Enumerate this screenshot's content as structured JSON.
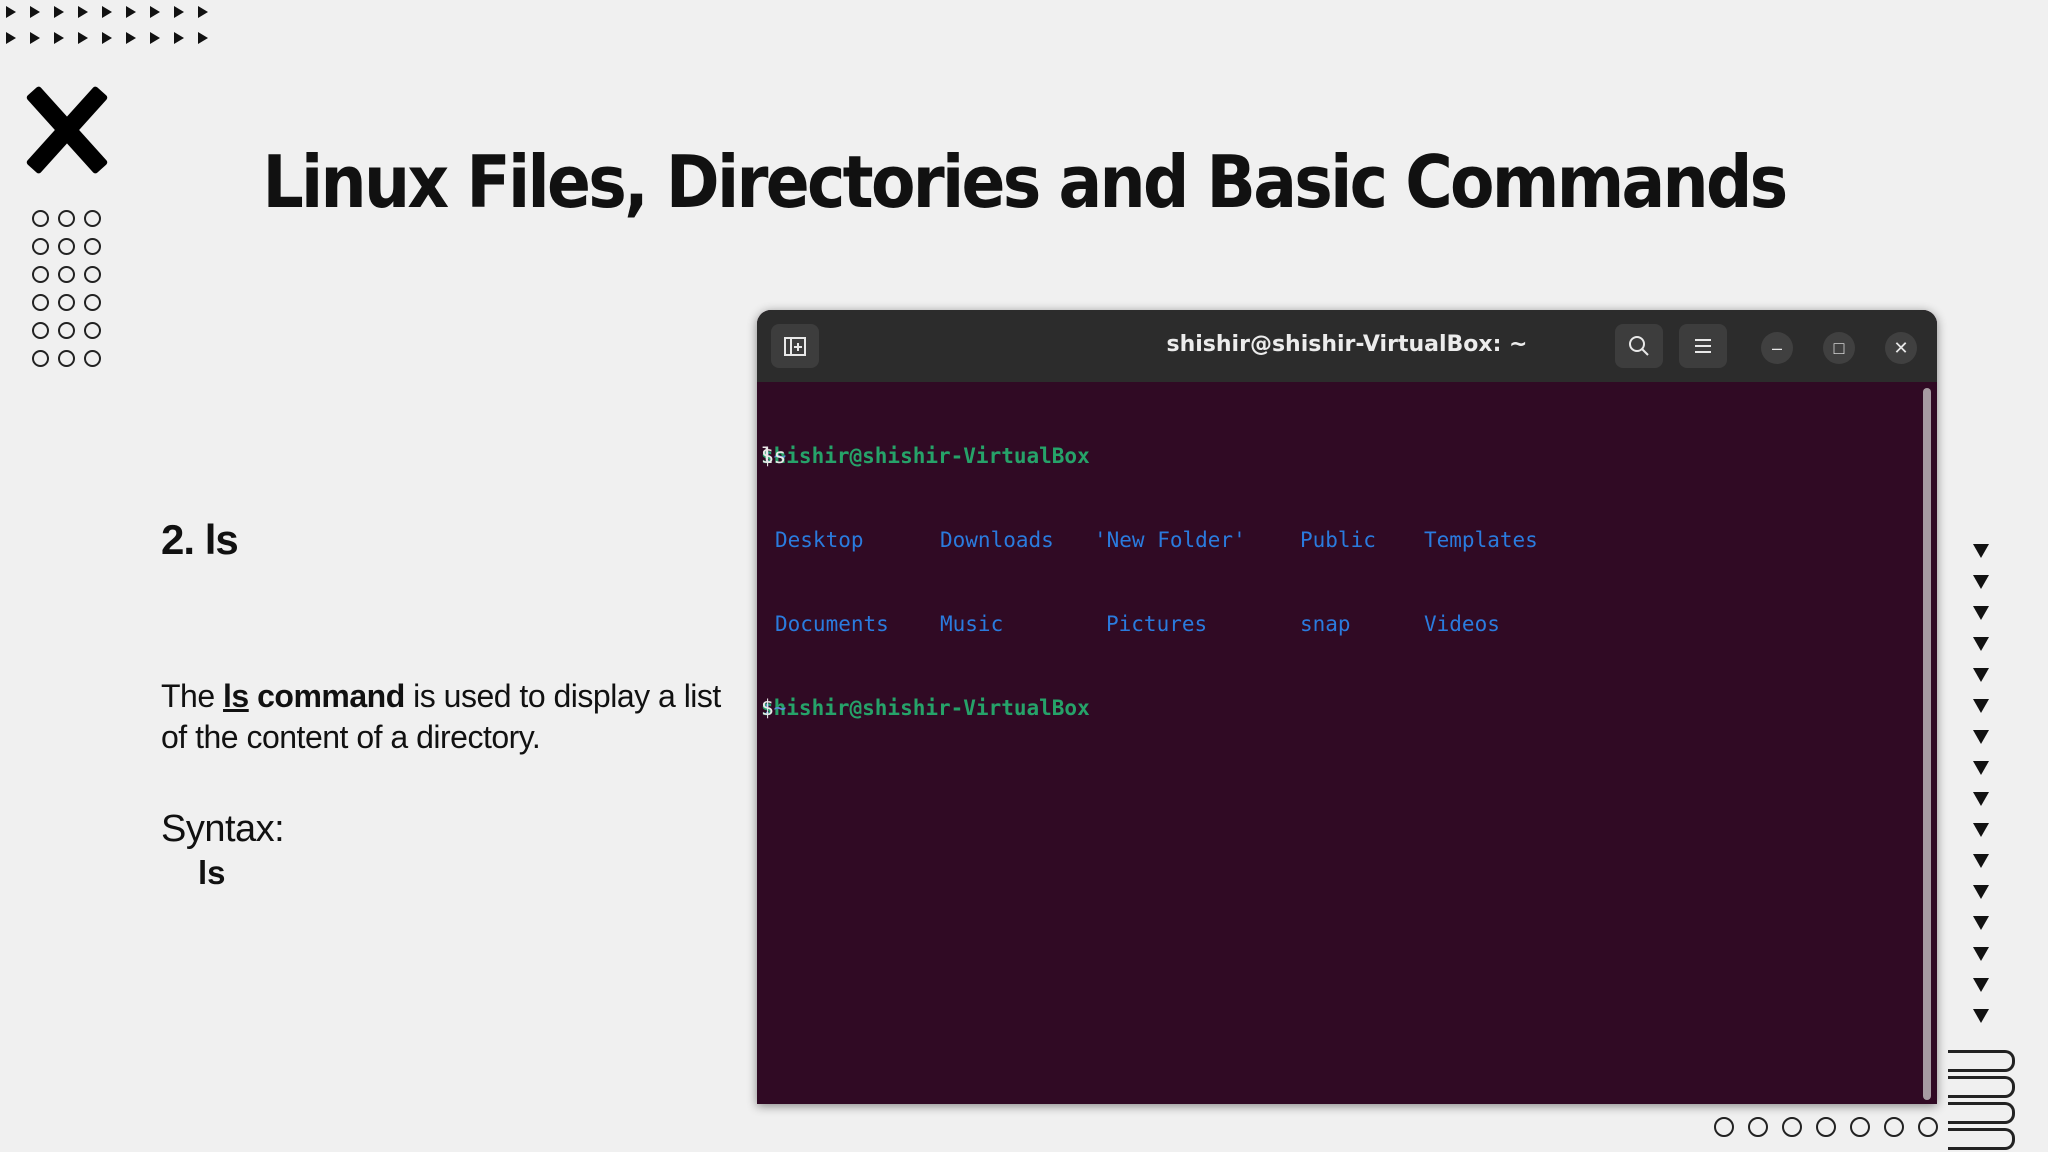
{
  "slide": {
    "title": "Linux Files, Directories and Basic Commands",
    "section_title": "2. ls",
    "description": {
      "prefix": "The ",
      "command": "ls",
      "command_word": " command",
      "suffix": " is used to display a list of the content of a directory."
    },
    "syntax_label": "Syntax:",
    "syntax_code": "ls"
  },
  "terminal": {
    "window_title": "shishir@shishir-VirtualBox: ~",
    "new_tab_icon": "new-tab-icon",
    "search_icon": "search-icon",
    "menu_icon": "hamburger-menu-icon",
    "minimize_glyph": "–",
    "maximize_glyph": "□",
    "close_glyph": "✕",
    "prompt_user": "shishir@shishir-VirtualBox",
    "prompt_path": ":~",
    "prompt_symbol": "$ ",
    "command": "ls",
    "listing": [
      [
        "Desktop",
        "Downloads",
        "'New Folder'",
        "Public",
        "Templates"
      ],
      [
        "Documents",
        "Music",
        "Pictures",
        "snap",
        "Videos"
      ]
    ],
    "colors": {
      "background": "#300a24",
      "prompt": "#26a269",
      "directory": "#2a7bde",
      "titlebar": "#2c2c2c"
    }
  }
}
